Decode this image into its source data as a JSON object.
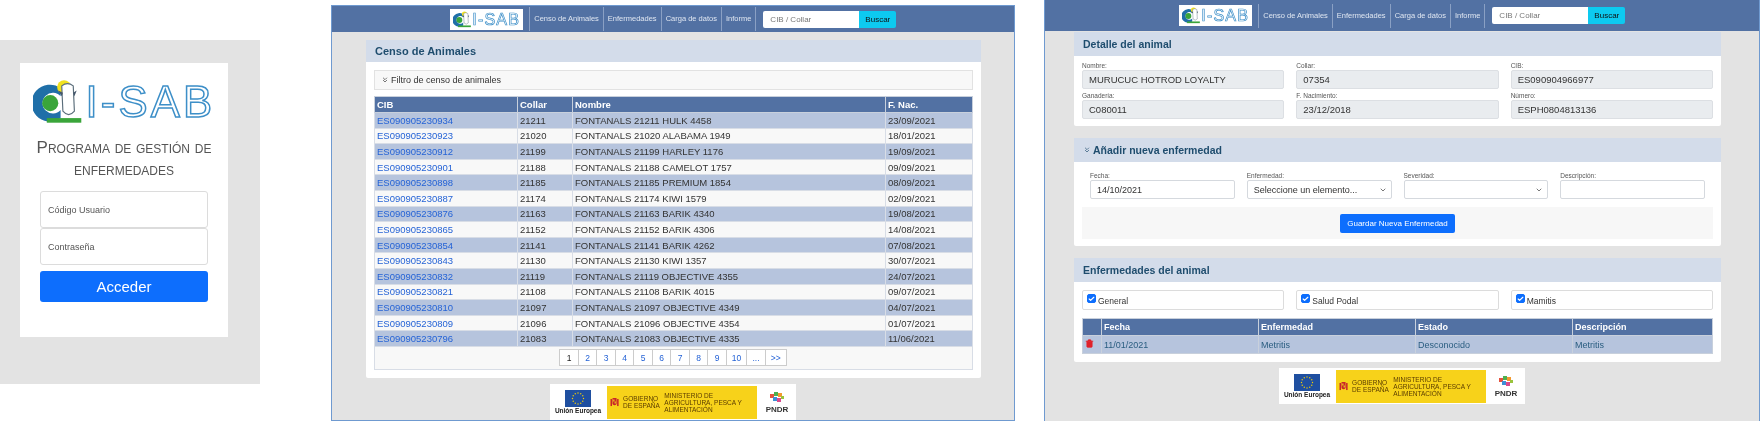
{
  "login": {
    "logo_text": "I-SAB",
    "title": "Programa de gestión de enfermedades",
    "fields": [
      {
        "placeholder": "Código Usuario"
      },
      {
        "placeholder": "Contraseña"
      }
    ],
    "button": "Acceder"
  },
  "census_page": {
    "navbar": {
      "logo_text": "I-SAB",
      "links": [
        "Censo de Animales",
        "Enfermedades",
        "Carga de datos",
        "Informe"
      ],
      "search_placeholder": "CIB / Collar",
      "search_button": "Buscar"
    },
    "title": "Censo de Animales",
    "filter_label": "Filtro de censo de animales",
    "table": {
      "columns": [
        "CIB",
        "Collar",
        "Nombre",
        "F. Nac."
      ],
      "rows": [
        [
          "ES090905230934",
          "21211",
          "FONTANALS 21211 HULK 4458",
          "23/09/2021"
        ],
        [
          "ES090905230923",
          "21020",
          "FONTANALS 21020 ALABAMA 1949",
          "18/01/2021"
        ],
        [
          "ES090905230912",
          "21199",
          "FONTANALS 21199 HARLEY 1176",
          "19/09/2021"
        ],
        [
          "ES090905230901",
          "21188",
          "FONTANALS 21188 CAMELOT 1757",
          "09/09/2021"
        ],
        [
          "ES090905230898",
          "21185",
          "FONTANALS 21185 PREMIUM 1854",
          "08/09/2021"
        ],
        [
          "ES090905230887",
          "21174",
          "FONTANALS 21174 KIWI 1579",
          "02/09/2021"
        ],
        [
          "ES090905230876",
          "21163",
          "FONTANALS 21163 BARIK 4340",
          "19/08/2021"
        ],
        [
          "ES090905230865",
          "21152",
          "FONTANALS 21152 BARIK 4306",
          "14/08/2021"
        ],
        [
          "ES090905230854",
          "21141",
          "FONTANALS 21141 BARIK 4262",
          "07/08/2021"
        ],
        [
          "ES090905230843",
          "21130",
          "FONTANALS 21130 KIWI 1357",
          "30/07/2021"
        ],
        [
          "ES090905230832",
          "21119",
          "FONTANALS 21119 OBJECTIVE 4355",
          "24/07/2021"
        ],
        [
          "ES090905230821",
          "21108",
          "FONTANALS 21108 BARIK 4015",
          "09/07/2021"
        ],
        [
          "ES090905230810",
          "21097",
          "FONTANALS 21097 OBJECTIVE 4349",
          "04/07/2021"
        ],
        [
          "ES090905230809",
          "21096",
          "FONTANALS 21096 OBJECTIVE 4354",
          "01/07/2021"
        ],
        [
          "ES090905230796",
          "21083",
          "FONTANALS 21083 OBJECTIVE 4335",
          "11/06/2021"
        ]
      ]
    },
    "pagination": [
      {
        "label": "1",
        "selected": true
      },
      {
        "label": "2",
        "selected": false
      },
      {
        "label": "3",
        "selected": false
      },
      {
        "label": "4",
        "selected": false
      },
      {
        "label": "5",
        "selected": false
      },
      {
        "label": "6",
        "selected": false
      },
      {
        "label": "7",
        "selected": false
      },
      {
        "label": "8",
        "selected": false
      },
      {
        "label": "9",
        "selected": false
      },
      {
        "label": "10",
        "selected": false
      },
      {
        "label": "...",
        "selected": false
      },
      {
        "label": ">>",
        "selected": false
      }
    ],
    "footer": {
      "eu": "Unión Europea",
      "government": "GOBIERNO DE ESPAÑA",
      "ministry": "MINISTERIO DE AGRICULTURA, PESCA Y ALIMENTACIÓN",
      "pndr": "PNDR"
    }
  },
  "detail_page": {
    "navbar": {
      "logo_text": "I-SAB",
      "links": [
        "Censo de Animales",
        "Enfermedades",
        "Carga de datos",
        "Informe"
      ],
      "search_placeholder": "CIB / Collar",
      "search_button": "Buscar"
    },
    "detail": {
      "title": "Detalle del animal",
      "fields": [
        {
          "label": "Nombre:",
          "value": "MURUCUC HOTROD LOYALTY"
        },
        {
          "label": "Collar:",
          "value": "07354"
        },
        {
          "label": "CIB:",
          "value": "ES090904966977"
        },
        {
          "label": "Ganadería:",
          "value": "C080011"
        },
        {
          "label": "F. Nacimiento:",
          "value": "23/12/2018"
        },
        {
          "label": "Número:",
          "value": "ESPH0804813136"
        }
      ]
    },
    "add_disease": {
      "title": "Añadir nueva enfermedad",
      "fields": [
        {
          "kind": "text",
          "label": "Fecha:",
          "value": "14/10/2021"
        },
        {
          "kind": "select",
          "label": "Enfermedad:",
          "value": "Seleccione un elemento..."
        },
        {
          "kind": "select",
          "label": "Severidad:"
        },
        {
          "kind": "text",
          "label": "Descripción:"
        }
      ],
      "button": "Guardar Nueva Enfermedad"
    },
    "diseases": {
      "title": "Enfermedades del animal",
      "filters": [
        {
          "label": "General",
          "checked": true
        },
        {
          "label": "Salud Podal",
          "checked": true
        },
        {
          "label": "Mamitis",
          "checked": true
        }
      ],
      "columns": [
        "Fecha",
        "Enfermedad",
        "Estado",
        "Descripción"
      ],
      "rows": [
        [
          "11/01/2021",
          "Metritis",
          "Desconocido",
          "Metritis"
        ]
      ]
    },
    "footer": {
      "eu": "Unión Europea",
      "government": "GOBIERNO DE ESPAÑA",
      "ministry": "MINISTERIO DE AGRICULTURA, PESCA Y ALIMENTACIÓN",
      "pndr": "PNDR"
    }
  }
}
